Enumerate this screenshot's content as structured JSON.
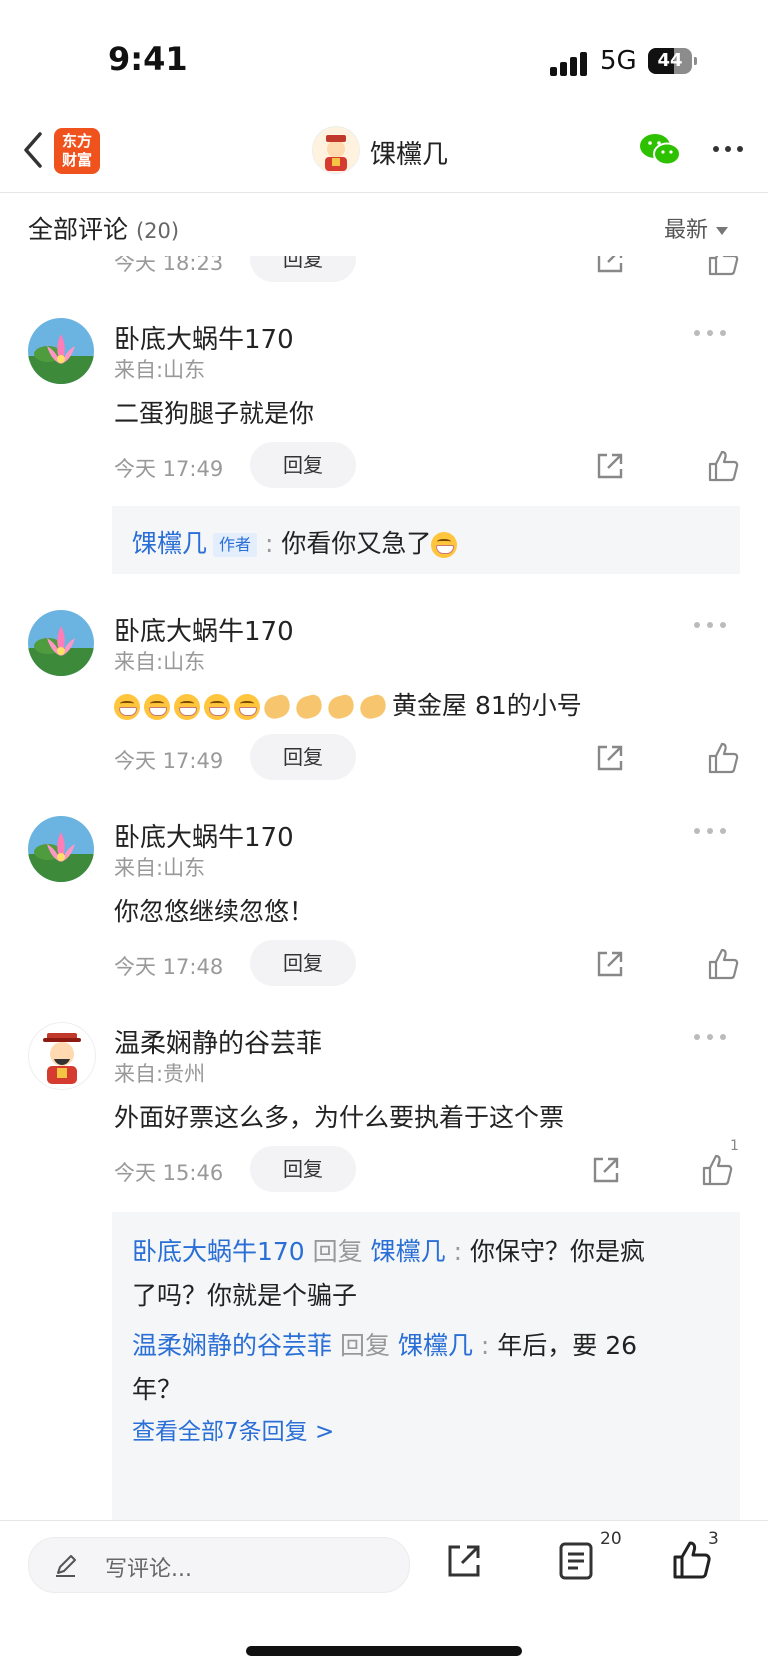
{
  "status": {
    "time": "9:41",
    "network": "5G",
    "battery": "44"
  },
  "nav": {
    "logo_line1": "东方",
    "logo_line2": "财富",
    "title": "馃欓几"
  },
  "header": {
    "label": "全部评论",
    "count": "(20)",
    "sort": "最新"
  },
  "top_partial": {
    "time": "今天 18:23",
    "reply": "回复"
  },
  "comments": [
    {
      "username": "卧底大蜗牛170",
      "location": "来自:山东",
      "text": "二蛋狗腿子就是你",
      "time": "今天 17:49",
      "reply": "回复",
      "author_reply": {
        "user": "馃欓几",
        "tag": "作者",
        "sep": ":",
        "text": "你看你又急了"
      }
    },
    {
      "username": "卧底大蜗牛170",
      "location": "来自:山东",
      "text": "黄金屋 81的小号",
      "time": "今天 17:49",
      "reply": "回复"
    },
    {
      "username": "卧底大蜗牛170",
      "location": "来自:山东",
      "text": "你忽悠继续忽悠！",
      "time": "今天 17:48",
      "reply": "回复"
    },
    {
      "username": "温柔娴静的谷芸菲",
      "location": "来自:贵州",
      "text": "外面好票这么多，为什么要执着于这个票",
      "time": "今天 15:46",
      "reply": "回复",
      "likes": "1",
      "replies": [
        {
          "from": "卧底大蜗牛170",
          "verb": "回复",
          "to": "馃欓几",
          "sep": ":",
          "text1": "你保守？你是疯",
          "text2": "了吗？你就是个骗子"
        },
        {
          "from": "温柔娴静的谷芸菲",
          "verb": "回复",
          "to": "馃欓几",
          "sep": ":",
          "text1": "年后，要 26",
          "text2": "年？"
        }
      ],
      "view_all": "查看全部7条回复 >"
    }
  ],
  "bottom": {
    "placeholder": "写评论...",
    "comment_count": "20",
    "like_count": "3"
  },
  "colors": {
    "accent_blue": "#2a6fd6",
    "brand_orange": "#f0521d",
    "wechat_green": "#2dc100"
  }
}
